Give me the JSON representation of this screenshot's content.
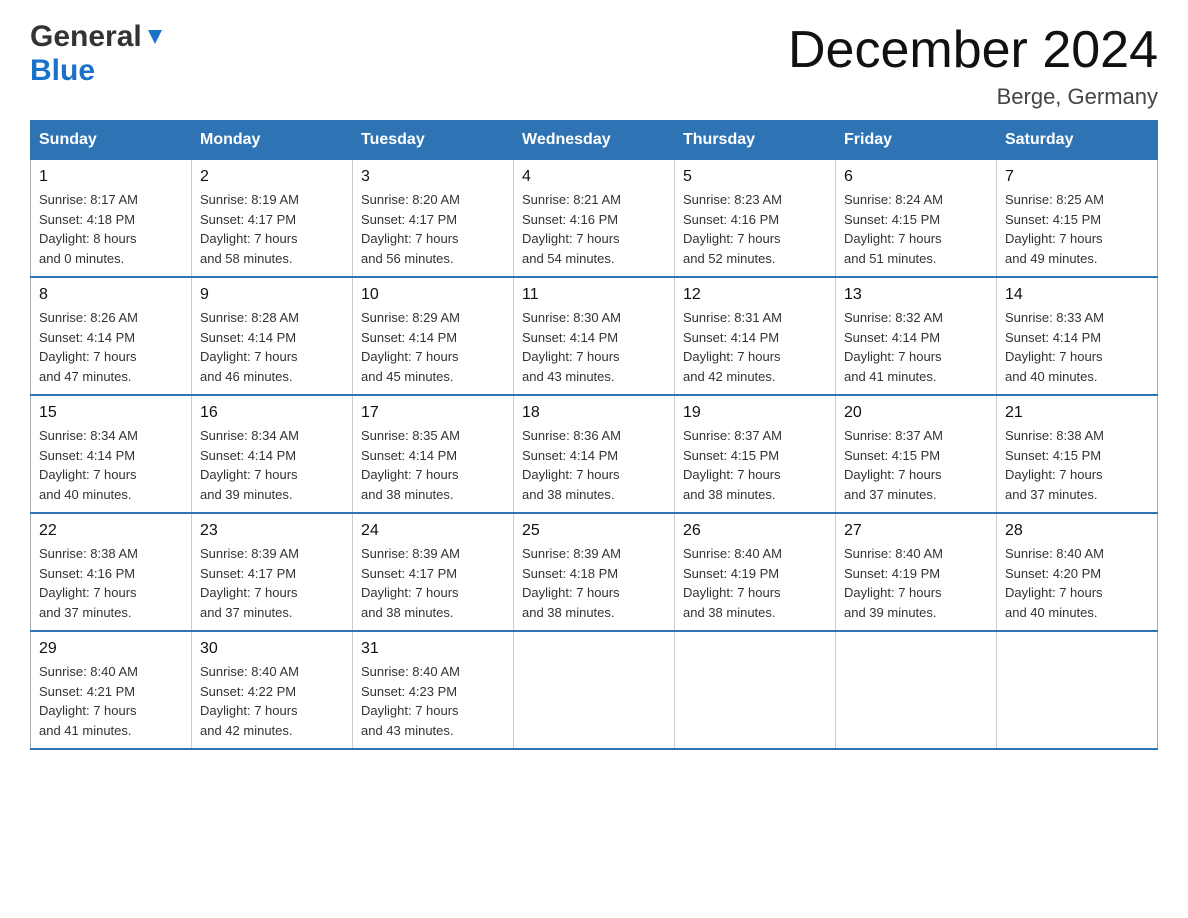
{
  "header": {
    "title": "December 2024",
    "subtitle": "Berge, Germany",
    "logo_general": "General",
    "logo_blue": "Blue"
  },
  "weekdays": [
    "Sunday",
    "Monday",
    "Tuesday",
    "Wednesday",
    "Thursday",
    "Friday",
    "Saturday"
  ],
  "weeks": [
    [
      {
        "day": "1",
        "sunrise": "8:17 AM",
        "sunset": "4:18 PM",
        "daylight": "8 hours and 0 minutes."
      },
      {
        "day": "2",
        "sunrise": "8:19 AM",
        "sunset": "4:17 PM",
        "daylight": "7 hours and 58 minutes."
      },
      {
        "day": "3",
        "sunrise": "8:20 AM",
        "sunset": "4:17 PM",
        "daylight": "7 hours and 56 minutes."
      },
      {
        "day": "4",
        "sunrise": "8:21 AM",
        "sunset": "4:16 PM",
        "daylight": "7 hours and 54 minutes."
      },
      {
        "day": "5",
        "sunrise": "8:23 AM",
        "sunset": "4:16 PM",
        "daylight": "7 hours and 52 minutes."
      },
      {
        "day": "6",
        "sunrise": "8:24 AM",
        "sunset": "4:15 PM",
        "daylight": "7 hours and 51 minutes."
      },
      {
        "day": "7",
        "sunrise": "8:25 AM",
        "sunset": "4:15 PM",
        "daylight": "7 hours and 49 minutes."
      }
    ],
    [
      {
        "day": "8",
        "sunrise": "8:26 AM",
        "sunset": "4:14 PM",
        "daylight": "7 hours and 47 minutes."
      },
      {
        "day": "9",
        "sunrise": "8:28 AM",
        "sunset": "4:14 PM",
        "daylight": "7 hours and 46 minutes."
      },
      {
        "day": "10",
        "sunrise": "8:29 AM",
        "sunset": "4:14 PM",
        "daylight": "7 hours and 45 minutes."
      },
      {
        "day": "11",
        "sunrise": "8:30 AM",
        "sunset": "4:14 PM",
        "daylight": "7 hours and 43 minutes."
      },
      {
        "day": "12",
        "sunrise": "8:31 AM",
        "sunset": "4:14 PM",
        "daylight": "7 hours and 42 minutes."
      },
      {
        "day": "13",
        "sunrise": "8:32 AM",
        "sunset": "4:14 PM",
        "daylight": "7 hours and 41 minutes."
      },
      {
        "day": "14",
        "sunrise": "8:33 AM",
        "sunset": "4:14 PM",
        "daylight": "7 hours and 40 minutes."
      }
    ],
    [
      {
        "day": "15",
        "sunrise": "8:34 AM",
        "sunset": "4:14 PM",
        "daylight": "7 hours and 40 minutes."
      },
      {
        "day": "16",
        "sunrise": "8:34 AM",
        "sunset": "4:14 PM",
        "daylight": "7 hours and 39 minutes."
      },
      {
        "day": "17",
        "sunrise": "8:35 AM",
        "sunset": "4:14 PM",
        "daylight": "7 hours and 38 minutes."
      },
      {
        "day": "18",
        "sunrise": "8:36 AM",
        "sunset": "4:14 PM",
        "daylight": "7 hours and 38 minutes."
      },
      {
        "day": "19",
        "sunrise": "8:37 AM",
        "sunset": "4:15 PM",
        "daylight": "7 hours and 38 minutes."
      },
      {
        "day": "20",
        "sunrise": "8:37 AM",
        "sunset": "4:15 PM",
        "daylight": "7 hours and 37 minutes."
      },
      {
        "day": "21",
        "sunrise": "8:38 AM",
        "sunset": "4:15 PM",
        "daylight": "7 hours and 37 minutes."
      }
    ],
    [
      {
        "day": "22",
        "sunrise": "8:38 AM",
        "sunset": "4:16 PM",
        "daylight": "7 hours and 37 minutes."
      },
      {
        "day": "23",
        "sunrise": "8:39 AM",
        "sunset": "4:17 PM",
        "daylight": "7 hours and 37 minutes."
      },
      {
        "day": "24",
        "sunrise": "8:39 AM",
        "sunset": "4:17 PM",
        "daylight": "7 hours and 38 minutes."
      },
      {
        "day": "25",
        "sunrise": "8:39 AM",
        "sunset": "4:18 PM",
        "daylight": "7 hours and 38 minutes."
      },
      {
        "day": "26",
        "sunrise": "8:40 AM",
        "sunset": "4:19 PM",
        "daylight": "7 hours and 38 minutes."
      },
      {
        "day": "27",
        "sunrise": "8:40 AM",
        "sunset": "4:19 PM",
        "daylight": "7 hours and 39 minutes."
      },
      {
        "day": "28",
        "sunrise": "8:40 AM",
        "sunset": "4:20 PM",
        "daylight": "7 hours and 40 minutes."
      }
    ],
    [
      {
        "day": "29",
        "sunrise": "8:40 AM",
        "sunset": "4:21 PM",
        "daylight": "7 hours and 41 minutes."
      },
      {
        "day": "30",
        "sunrise": "8:40 AM",
        "sunset": "4:22 PM",
        "daylight": "7 hours and 42 minutes."
      },
      {
        "day": "31",
        "sunrise": "8:40 AM",
        "sunset": "4:23 PM",
        "daylight": "7 hours and 43 minutes."
      },
      null,
      null,
      null,
      null
    ]
  ],
  "labels": {
    "sunrise": "Sunrise:",
    "sunset": "Sunset:",
    "daylight": "Daylight:"
  }
}
